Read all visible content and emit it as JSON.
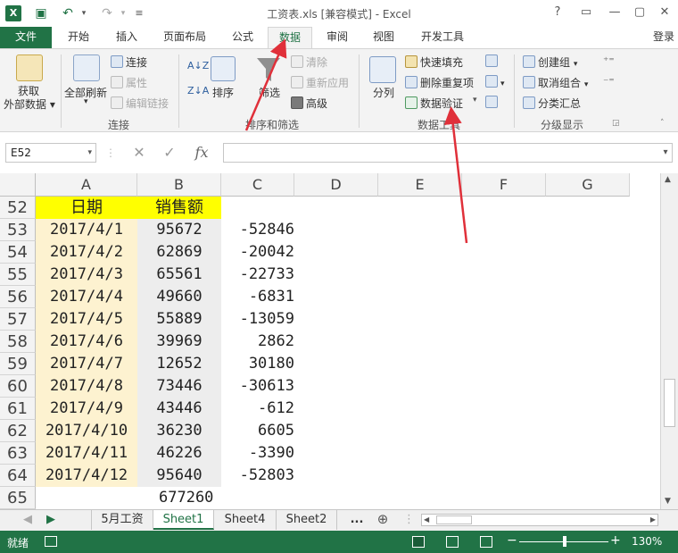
{
  "window": {
    "title": "工资表.xls  [兼容模式] - Excel",
    "controls": [
      "?",
      "▭",
      "—",
      "▢",
      "✕"
    ]
  },
  "quick_access": {
    "save_icon": "save-icon",
    "undo_icon": "undo-icon",
    "redo_icon": "redo-icon"
  },
  "account": "登录",
  "tabs": [
    {
      "label": "文件"
    },
    {
      "label": "开始"
    },
    {
      "label": "插入"
    },
    {
      "label": "页面布局"
    },
    {
      "label": "公式"
    },
    {
      "label": "数据"
    },
    {
      "label": "审阅"
    },
    {
      "label": "视图"
    },
    {
      "label": "开发工具"
    }
  ],
  "active_tab": "数据",
  "ribbon": {
    "get_external": {
      "line1": "获取",
      "line2": "外部数据 ▾"
    },
    "refresh_all": "全部刷新",
    "connections": {
      "connect": "连接",
      "properties": "属性",
      "edit_links": "编辑链接",
      "group_label": "连接"
    },
    "sort_filter": {
      "sort": "排序",
      "filter": "筛选",
      "clear": "清除",
      "reapply": "重新应用",
      "advanced": "高级",
      "group_label": "排序和筛选",
      "az": "A↓Z",
      "za": "Z↓A"
    },
    "data_tools": {
      "text_to_columns": "分列",
      "flash_fill": "快速填充",
      "remove_duplicates": "删除重复项",
      "data_validation": "数据验证",
      "group_label": "数据工具"
    },
    "outline": {
      "group": "创建组",
      "ungroup": "取消组合",
      "subtotal": "分类汇总",
      "group_label": "分级显示"
    }
  },
  "formula_bar": {
    "name_box": "E52",
    "fx": "fx",
    "value": ""
  },
  "columns": [
    "A",
    "B",
    "C",
    "D",
    "E",
    "F",
    "G"
  ],
  "rows": [
    {
      "num": "52",
      "a": "日期",
      "b": "销售额",
      "c": ""
    },
    {
      "num": "53",
      "a": "2017/4/1",
      "b": "95672",
      "c": "-52846"
    },
    {
      "num": "54",
      "a": "2017/4/2",
      "b": "62869",
      "c": "-20042"
    },
    {
      "num": "55",
      "a": "2017/4/3",
      "b": "65561",
      "c": "-22733"
    },
    {
      "num": "56",
      "a": "2017/4/4",
      "b": "49660",
      "c": "-6831"
    },
    {
      "num": "57",
      "a": "2017/4/5",
      "b": "55889",
      "c": "-13059"
    },
    {
      "num": "58",
      "a": "2017/4/6",
      "b": "39969",
      "c": "2862"
    },
    {
      "num": "59",
      "a": "2017/4/7",
      "b": "12652",
      "c": "30180"
    },
    {
      "num": "60",
      "a": "2017/4/8",
      "b": "73446",
      "c": "-30613"
    },
    {
      "num": "61",
      "a": "2017/4/9",
      "b": "43446",
      "c": "-612"
    },
    {
      "num": "62",
      "a": "2017/4/10",
      "b": "36230",
      "c": "6605"
    },
    {
      "num": "63",
      "a": "2017/4/11",
      "b": "46226",
      "c": "-3390"
    },
    {
      "num": "64",
      "a": "2017/4/12",
      "b": "95640",
      "c": "-52803"
    },
    {
      "num": "65",
      "a": "",
      "b": "677260",
      "c": ""
    }
  ],
  "sheets": {
    "tabs": [
      "5月工资",
      "Sheet1",
      "Sheet4",
      "Sheet2"
    ],
    "active": "Sheet1",
    "more": "...",
    "add": "⊕"
  },
  "status": {
    "ready": "就绪",
    "zoom": "130%"
  },
  "colors": {
    "accent": "#217346",
    "header_fill": "#ffff00",
    "date_fill": "#fdf2d0",
    "sales_fill": "#ededed",
    "annotation_arrow": "#e0303a"
  }
}
